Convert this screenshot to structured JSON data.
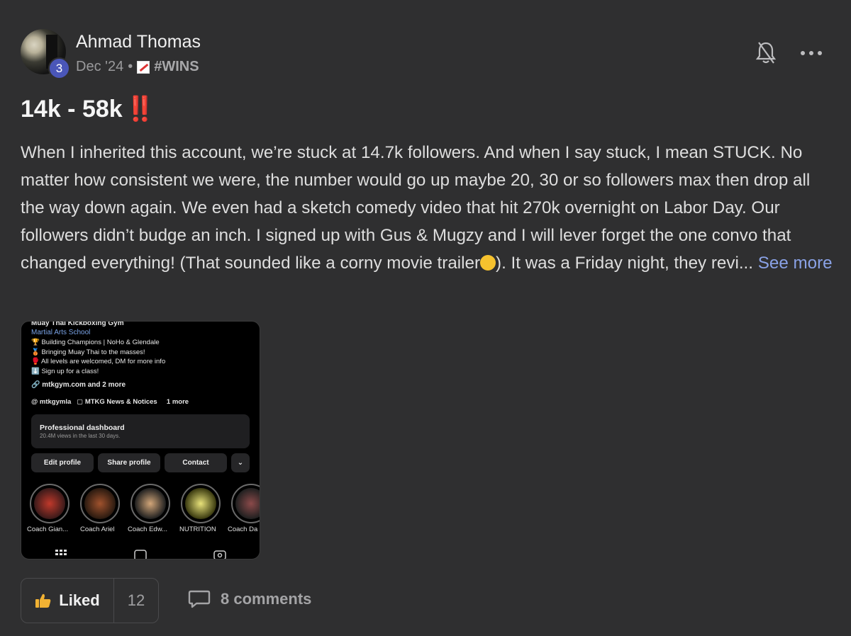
{
  "post": {
    "author": "Ahmad Thomas",
    "level": "3",
    "date": "Dec '24",
    "separator": "•",
    "category": "#WINS",
    "title": "14k - 58k",
    "title_emoji": "‼️",
    "body_part1": "When I inherited this account, we’re stuck at 14.7k followers. And when I say stuck, I mean STUCK. No matter how consistent we were, the number would go up maybe 20, 30 or so followers max then drop all the way down again. We even had a sketch comedy video that hit 270k overnight on Labor Day. Our followers didn’t budge an inch. I signed up with Gus & Mugzy and I will lever forget the one convo that changed everything! (That sounded like a corny movie trailer",
    "body_part2": "). It was a Friday night, they revi...",
    "see_more": "See more"
  },
  "attachment": {
    "line_top": "Muay Thai Kickboxing Gym",
    "category": "Martial Arts School",
    "bio": [
      "🏆 Building Champions | NoHo & Glendale",
      "🥉 Bringing Muay Thai to the masses!",
      "🥊 All levels are welcomed, DM for more info",
      "⬇️ Sign up for a class!"
    ],
    "link": "mtkgym.com and 2 more",
    "threads_handle": "mtkgymla",
    "channel": "MTKG News & Notices",
    "channel_more": "1 more",
    "dashboard_title": "Professional dashboard",
    "dashboard_sub": "20.4M views in the last 30 days.",
    "buttons": [
      "Edit profile",
      "Share profile",
      "Contact"
    ],
    "highlights": [
      "Coach Gian...",
      "Coach Ariel",
      "Coach Edw...",
      "NUTRITION",
      "Coach Da"
    ]
  },
  "actions": {
    "liked_label": "Liked",
    "like_count": "12",
    "comments_label": "8 comments"
  },
  "colors": {
    "background": "#2f2f30",
    "link": "#8aa2e6",
    "level_badge": "#4a56b8",
    "title_emoji": "#e53935"
  }
}
